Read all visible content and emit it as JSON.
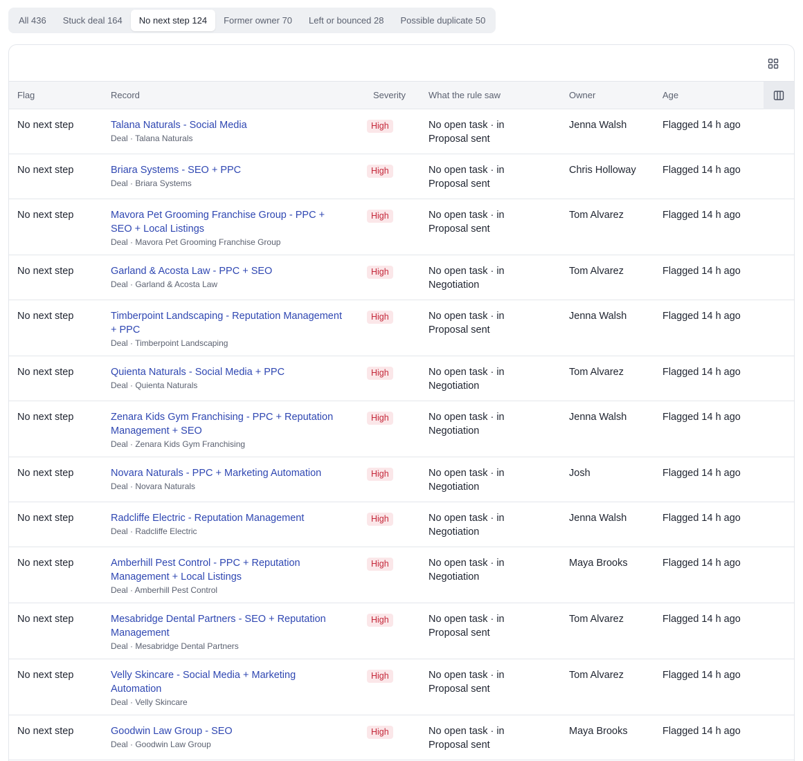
{
  "tabs": [
    {
      "label": "All 436",
      "active": false
    },
    {
      "label": "Stuck deal 164",
      "active": false
    },
    {
      "label": "No next step 124",
      "active": true
    },
    {
      "label": "Former owner 70",
      "active": false
    },
    {
      "label": "Left or bounced 28",
      "active": false
    },
    {
      "label": "Possible duplicate 50",
      "active": false
    }
  ],
  "columns": {
    "flag": "Flag",
    "record": "Record",
    "severity": "Severity",
    "saw": "What the rule saw",
    "owner": "Owner",
    "age": "Age"
  },
  "rows": [
    {
      "flag": "No next step",
      "title": "Talana Naturals - Social Media",
      "sub": "Deal · Talana Naturals",
      "severity": "High",
      "saw": "No open task · in Proposal sent",
      "owner": "Jenna Walsh",
      "age": "Flagged 14 h ago"
    },
    {
      "flag": "No next step",
      "title": "Briara Systems - SEO + PPC",
      "sub": "Deal · Briara Systems",
      "severity": "High",
      "saw": "No open task · in Proposal sent",
      "owner": "Chris Holloway",
      "age": "Flagged 14 h ago"
    },
    {
      "flag": "No next step",
      "title": "Mavora Pet Grooming Franchise Group - PPC + SEO + Local Listings",
      "sub": "Deal · Mavora Pet Grooming Franchise Group",
      "severity": "High",
      "saw": "No open task · in Proposal sent",
      "owner": "Tom Alvarez",
      "age": "Flagged 14 h ago"
    },
    {
      "flag": "No next step",
      "title": "Garland & Acosta Law - PPC + SEO",
      "sub": "Deal · Garland & Acosta Law",
      "severity": "High",
      "saw": "No open task · in Negotiation",
      "owner": "Tom Alvarez",
      "age": "Flagged 14 h ago"
    },
    {
      "flag": "No next step",
      "title": "Timberpoint Landscaping - Reputation Management + PPC",
      "sub": "Deal · Timberpoint Landscaping",
      "severity": "High",
      "saw": "No open task · in Proposal sent",
      "owner": "Jenna Walsh",
      "age": "Flagged 14 h ago"
    },
    {
      "flag": "No next step",
      "title": "Quienta Naturals - Social Media + PPC",
      "sub": "Deal · Quienta Naturals",
      "severity": "High",
      "saw": "No open task · in Negotiation",
      "owner": "Tom Alvarez",
      "age": "Flagged 14 h ago"
    },
    {
      "flag": "No next step",
      "title": "Zenara Kids Gym Franchising - PPC + Reputation Management + SEO",
      "sub": "Deal · Zenara Kids Gym Franchising",
      "severity": "High",
      "saw": "No open task · in Negotiation",
      "owner": "Jenna Walsh",
      "age": "Flagged 14 h ago"
    },
    {
      "flag": "No next step",
      "title": "Novara Naturals - PPC + Marketing Automation",
      "sub": "Deal · Novara Naturals",
      "severity": "High",
      "saw": "No open task · in Negotiation",
      "owner": "Josh",
      "age": "Flagged 14 h ago"
    },
    {
      "flag": "No next step",
      "title": "Radcliffe Electric - Reputation Management",
      "sub": "Deal · Radcliffe Electric",
      "severity": "High",
      "saw": "No open task · in Negotiation",
      "owner": "Jenna Walsh",
      "age": "Flagged 14 h ago"
    },
    {
      "flag": "No next step",
      "title": "Amberhill Pest Control - PPC + Reputation Management + Local Listings",
      "sub": "Deal · Amberhill Pest Control",
      "severity": "High",
      "saw": "No open task · in Negotiation",
      "owner": "Maya Brooks",
      "age": "Flagged 14 h ago"
    },
    {
      "flag": "No next step",
      "title": "Mesabridge Dental Partners - SEO + Reputation Management",
      "sub": "Deal · Mesabridge Dental Partners",
      "severity": "High",
      "saw": "No open task · in Proposal sent",
      "owner": "Tom Alvarez",
      "age": "Flagged 14 h ago"
    },
    {
      "flag": "No next step",
      "title": "Velly Skincare - Social Media + Marketing Automation",
      "sub": "Deal · Velly Skincare",
      "severity": "High",
      "saw": "No open task · in Proposal sent",
      "owner": "Tom Alvarez",
      "age": "Flagged 14 h ago"
    },
    {
      "flag": "No next step",
      "title": "Goodwin Law Group - SEO",
      "sub": "Deal · Goodwin Law Group",
      "severity": "High",
      "saw": "No open task · in Proposal sent",
      "owner": "Maya Brooks",
      "age": "Flagged 14 h ago"
    }
  ]
}
